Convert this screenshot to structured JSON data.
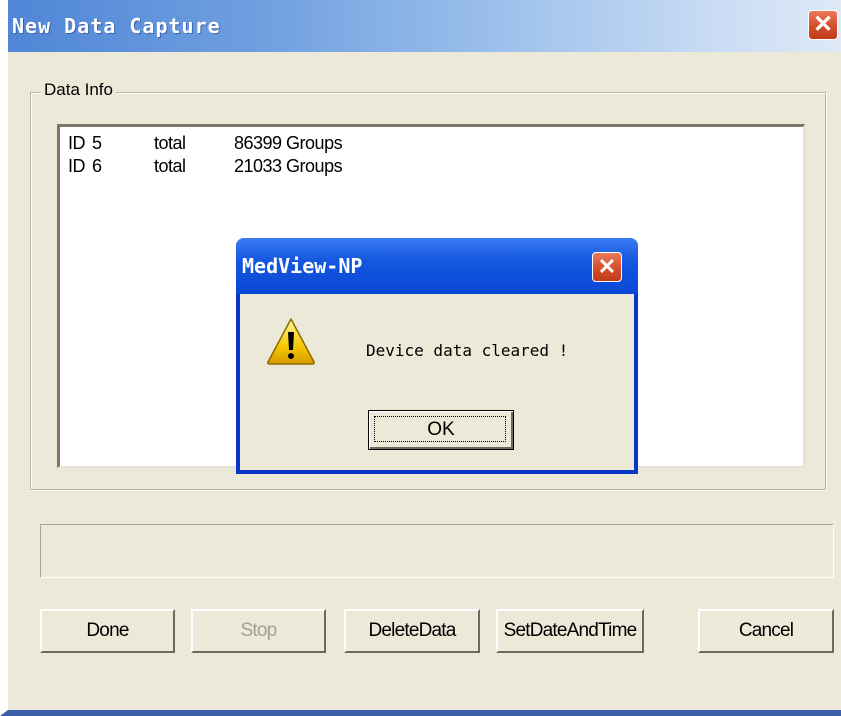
{
  "window": {
    "title": "New Data Capture"
  },
  "data_info": {
    "label": "Data Info",
    "rows": [
      {
        "id_label": "ID",
        "id": "5",
        "total_label": "total",
        "groups": "86399 Groups"
      },
      {
        "id_label": "ID",
        "id": "6",
        "total_label": "total",
        "groups": "21033 Groups"
      }
    ]
  },
  "status_field": {
    "value": ""
  },
  "buttons": {
    "done": "Done",
    "stop": "Stop",
    "delete": "DeleteData",
    "set_date_time": "SetDateAndTime",
    "cancel": "Cancel"
  },
  "message_box": {
    "title": "MedView-NP",
    "message": "Device data cleared !",
    "ok": "OK",
    "icon": "warning-icon"
  },
  "close_glyph": "✕",
  "colors": {
    "title_bar_start": "#4f86d6",
    "dialog_title_bar": "#1457e0",
    "close_button": "#d54e2b",
    "window_face": "#ece9d8"
  }
}
